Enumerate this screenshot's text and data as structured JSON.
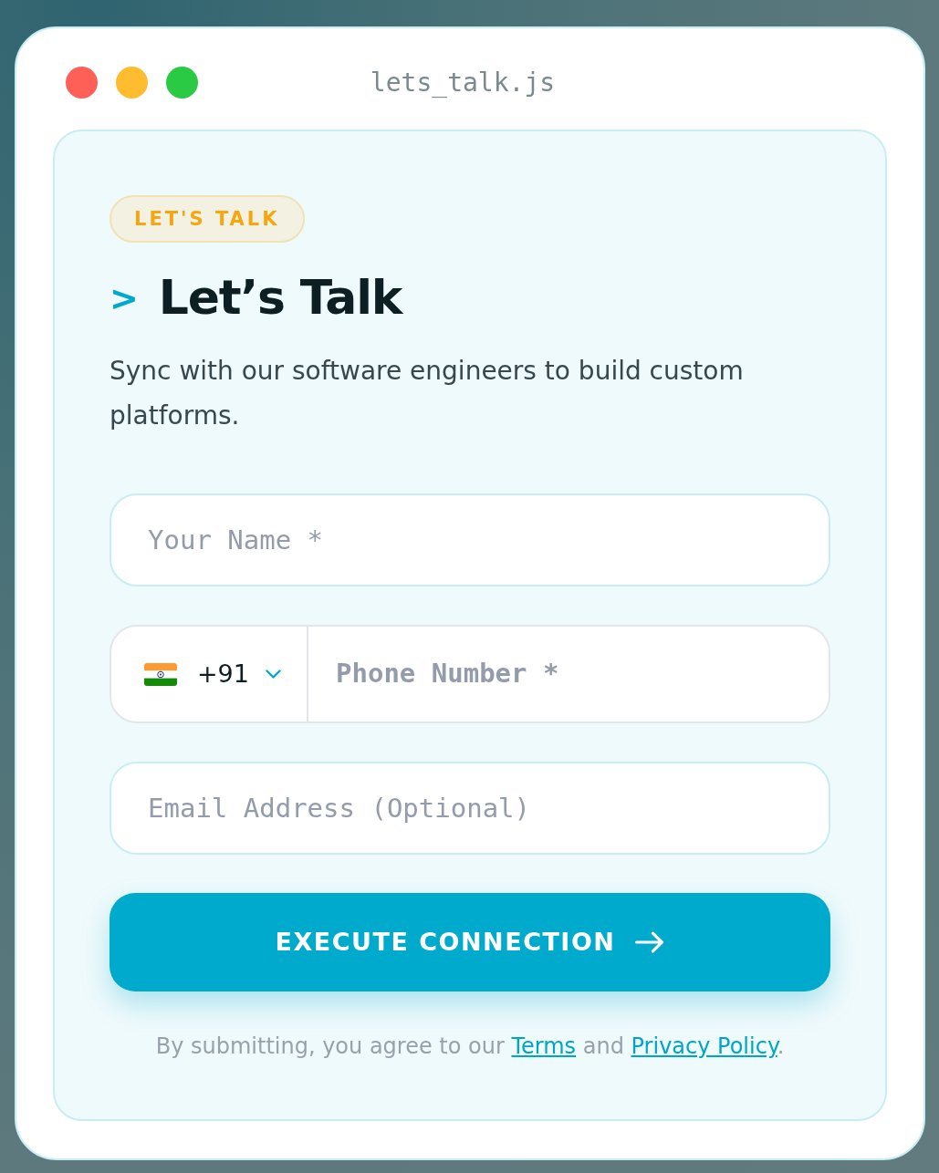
{
  "window": {
    "title": "lets_talk.js",
    "traffic_lights": [
      {
        "color": "#fe5f57"
      },
      {
        "color": "#ffbc2e"
      },
      {
        "color": "#2bca44"
      }
    ]
  },
  "badge": "LET'S TALK",
  "heading": {
    "prompt": ">",
    "text": "Let’s Talk"
  },
  "intro": "Sync with our software engineers to build custom platforms.",
  "fields": [
    {
      "kind": "text",
      "placeholder": "Your Name *"
    },
    {
      "kind": "phone",
      "country_code": "+91",
      "placeholder": "Phone Number *"
    },
    {
      "kind": "text",
      "placeholder": "Email Address (Optional)"
    }
  ],
  "submit": {
    "label": "EXECUTE CONNECTION"
  },
  "consent": [
    {
      "kind": "text",
      "text": "By submitting, you agree to our "
    },
    {
      "kind": "link",
      "text": "Terms"
    },
    {
      "kind": "text",
      "text": " and "
    },
    {
      "kind": "link",
      "text": "Privacy Policy"
    },
    {
      "kind": "text",
      "text": "."
    }
  ]
}
